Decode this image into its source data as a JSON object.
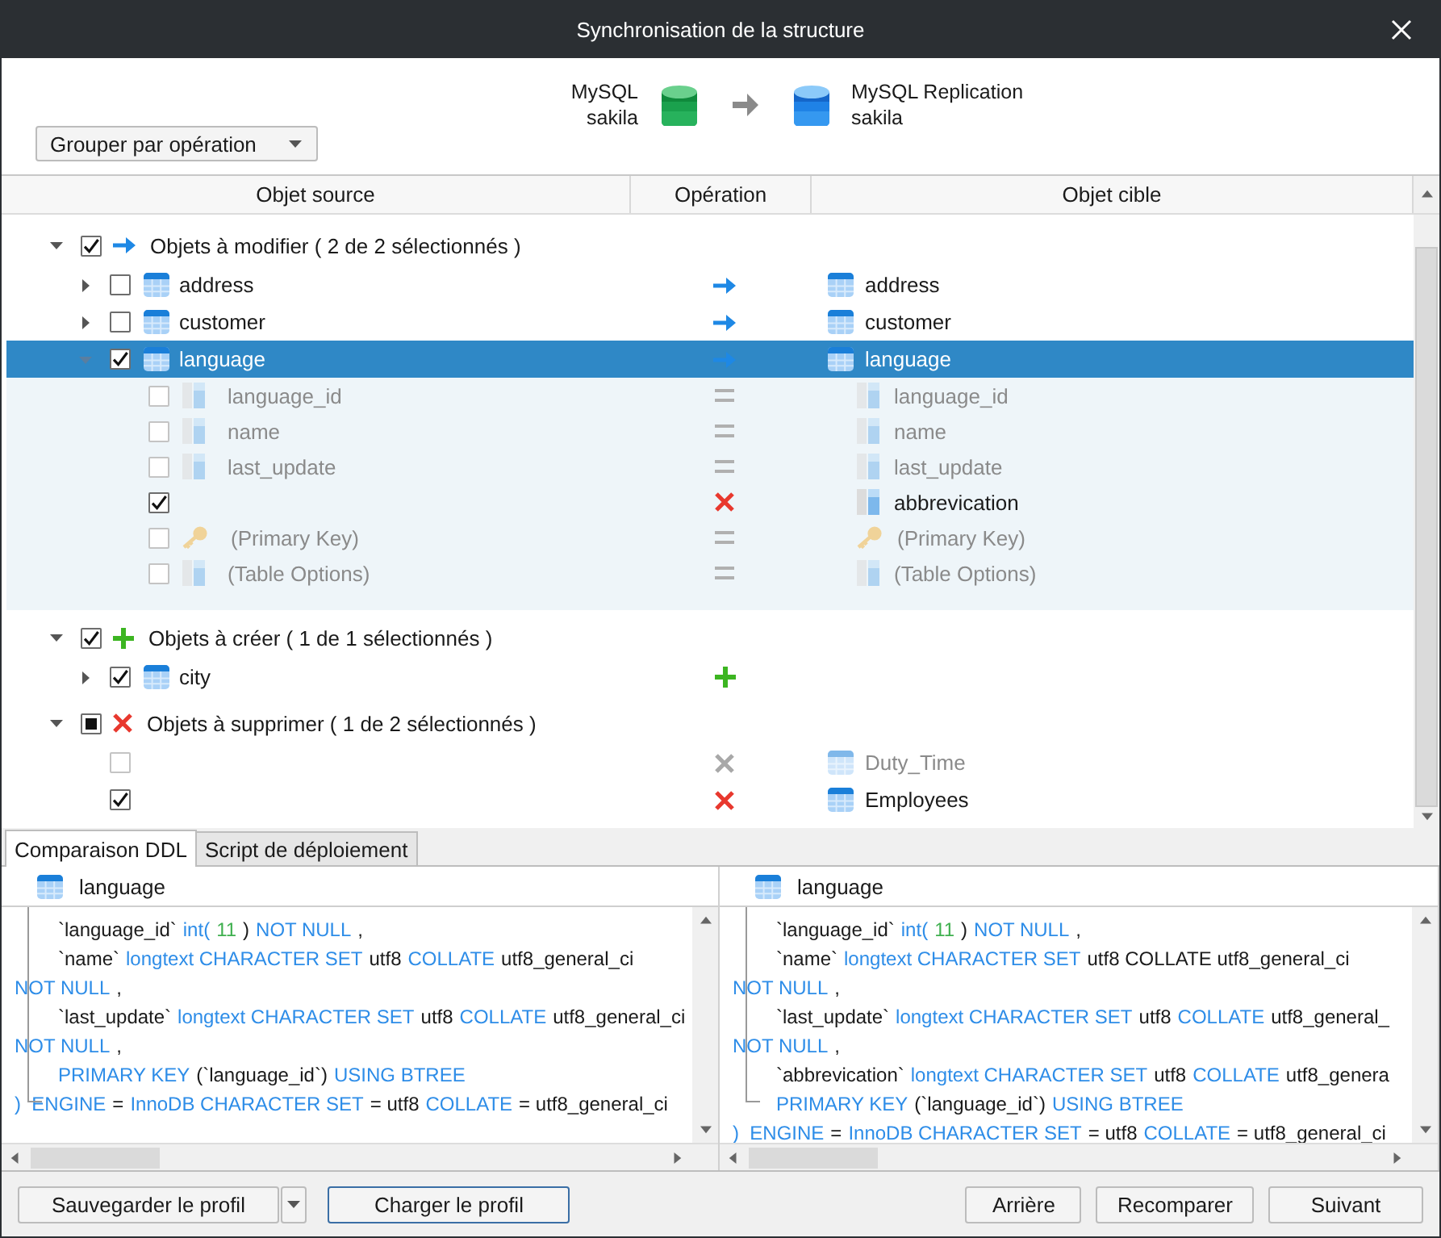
{
  "window": {
    "title": "Synchronisation de la structure"
  },
  "source": {
    "server": "MySQL",
    "database": "sakila"
  },
  "target": {
    "server": "MySQL Replication",
    "database": "sakila"
  },
  "group_by": {
    "value": "Grouper par opération"
  },
  "columns": [
    "Objet source",
    "Opération",
    "Objet cible"
  ],
  "groups": [
    {
      "label": "Objets à modifier ( 2 de 2 sélectionnés )",
      "kind": "modify",
      "checked": true,
      "expanded": true,
      "items": [
        {
          "source": "address",
          "target": "address",
          "kind": "table",
          "operation": {
            "kind": "modify"
          },
          "checked": false,
          "selected": false,
          "dimmed": false,
          "expanded": false
        },
        {
          "source": "customer",
          "target": "customer",
          "kind": "table",
          "operation": {
            "kind": "modify"
          },
          "checked": false,
          "selected": false,
          "dimmed": false,
          "expanded": false
        },
        {
          "source": "language",
          "target": "language",
          "kind": "table",
          "operation": {
            "kind": "modify"
          },
          "checked": true,
          "selected": true,
          "dimmed": false,
          "expanded": true,
          "children": [
            {
              "source": "language_id",
              "target": "language_id",
              "kind": "column",
              "operation": {
                "kind": "equal"
              },
              "checked": false,
              "selected": false,
              "dimmed": true
            },
            {
              "source": "name",
              "target": "name",
              "kind": "column",
              "operation": {
                "kind": "equal"
              },
              "checked": false,
              "selected": false,
              "dimmed": true
            },
            {
              "source": "last_update",
              "target": "last_update",
              "kind": "column",
              "operation": {
                "kind": "equal"
              },
              "checked": false,
              "selected": false,
              "dimmed": true
            },
            {
              "target": "abbrevication",
              "kind": "column",
              "operation": {
                "kind": "delete"
              },
              "checked": true,
              "selected": false,
              "dimmed": false
            },
            {
              "source": "(Primary Key)",
              "target": "(Primary Key)",
              "kind": "key",
              "operation": {
                "kind": "equal"
              },
              "checked": false,
              "selected": false,
              "dimmed": true
            },
            {
              "source": "(Table Options)",
              "target": "(Table Options)",
              "kind": "column",
              "operation": {
                "kind": "equal"
              },
              "checked": false,
              "selected": false,
              "dimmed": true
            }
          ]
        }
      ]
    },
    {
      "label": "Objets à créer ( 1 de 1 sélectionnés )",
      "kind": "create",
      "checked": true,
      "expanded": true,
      "items": [
        {
          "source": "city",
          "kind": "table",
          "operation": {
            "kind": "create"
          },
          "checked": true,
          "selected": false,
          "dimmed": false,
          "expanded": false
        }
      ]
    },
    {
      "label": "Objets à supprimer ( 1 de 2 sélectionnés )",
      "kind": "delete",
      "checked": true,
      "partial": true,
      "expanded": true,
      "items": [
        {
          "target": "Duty_Time",
          "kind": "table",
          "operation": {
            "kind": "delete"
          },
          "checked": false,
          "selected": false,
          "dimmed": true
        },
        {
          "target": "Employees",
          "kind": "table",
          "operation": {
            "kind": "delete"
          },
          "checked": true,
          "selected": false,
          "dimmed": false
        }
      ]
    }
  ],
  "ddl_tabs": [
    {
      "label": "Comparaison DDL",
      "selected": true
    },
    {
      "label": "Script de déploiement",
      "selected": false
    }
  ],
  "ddl_panels": [
    {
      "title": "language",
      "lines": [
        {
          "indented": true,
          "tokens": [
            {
              "t": "`language_id`",
              "kind": "txt"
            },
            {
              "t": "int(",
              "kind": "kw"
            },
            {
              "t": "11",
              "kind": "num"
            },
            {
              "t": ")",
              "kind": "txt"
            },
            {
              "t": "NOT NULL",
              "kind": "kw"
            },
            {
              "t": ",",
              "kind": "txt"
            }
          ]
        },
        {
          "indented": true,
          "tokens": [
            {
              "t": "`name`",
              "kind": "txt"
            },
            {
              "t": "longtext CHARACTER SET",
              "kind": "kw"
            },
            {
              "t": "utf8",
              "kind": "txt"
            },
            {
              "t": "COLLATE",
              "kind": "kw"
            },
            {
              "t": "utf8_general_ci",
              "kind": "txt"
            }
          ]
        },
        {
          "indented": false,
          "tokens": [
            {
              "t": "NOT NULL",
              "kind": "kw"
            },
            {
              "t": ",",
              "kind": "txt"
            }
          ]
        },
        {
          "indented": true,
          "tokens": [
            {
              "t": "`last_update`",
              "kind": "txt"
            },
            {
              "t": "longtext CHARACTER SET",
              "kind": "kw"
            },
            {
              "t": "utf8",
              "kind": "txt"
            },
            {
              "t": "COLLATE",
              "kind": "kw"
            },
            {
              "t": "utf8_general_ci",
              "kind": "txt"
            }
          ]
        },
        {
          "indented": false,
          "tokens": [
            {
              "t": "NOT NULL",
              "kind": "kw"
            },
            {
              "t": ",",
              "kind": "txt"
            }
          ]
        },
        {
          "indented": true,
          "tokens": [
            {
              "t": "PRIMARY KEY",
              "kind": "kw"
            },
            {
              "t": "(`language_id`)",
              "kind": "txt"
            },
            {
              "t": "USING BTREE",
              "kind": "kw"
            }
          ]
        },
        {
          "indented": false,
          "tokens": [
            {
              "t": ")  ENGINE",
              "kind": "kw"
            },
            {
              "t": "=",
              "kind": "txt"
            },
            {
              "t": "InnoDB CHARACTER SET",
              "kind": "kw"
            },
            {
              "t": "= utf8",
              "kind": "txt"
            },
            {
              "t": "COLLATE",
              "kind": "kw"
            },
            {
              "t": "= utf8_general_ci",
              "kind": "txt"
            }
          ]
        }
      ]
    },
    {
      "title": "language",
      "lines": [
        {
          "indented": true,
          "tokens": [
            {
              "t": "`language_id`",
              "kind": "txt"
            },
            {
              "t": "int(",
              "kind": "kw"
            },
            {
              "t": "11",
              "kind": "num"
            },
            {
              "t": ")",
              "kind": "txt"
            },
            {
              "t": "NOT NULL",
              "kind": "kw"
            },
            {
              "t": ",",
              "kind": "txt"
            }
          ]
        },
        {
          "indented": true,
          "tokens": [
            {
              "t": "`name`",
              "kind": "txt"
            },
            {
              "t": "longtext CHARACTER SET",
              "kind": "kw"
            },
            {
              "t": "utf8 COLLATE utf8_general_ci",
              "kind": "txt"
            }
          ]
        },
        {
          "indented": false,
          "tokens": [
            {
              "t": "NOT NULL",
              "kind": "kw"
            },
            {
              "t": ",",
              "kind": "txt"
            }
          ]
        },
        {
          "indented": true,
          "tokens": [
            {
              "t": "`last_update`",
              "kind": "txt"
            },
            {
              "t": "longtext CHARACTER SET",
              "kind": "kw"
            },
            {
              "t": "utf8",
              "kind": "txt"
            },
            {
              "t": "COLLATE",
              "kind": "kw"
            },
            {
              "t": "utf8_general_",
              "kind": "txt"
            }
          ]
        },
        {
          "indented": false,
          "tokens": [
            {
              "t": "NOT NULL",
              "kind": "kw"
            },
            {
              "t": ",",
              "kind": "txt"
            }
          ]
        },
        {
          "indented": true,
          "tokens": [
            {
              "t": "`abbrevication`",
              "kind": "txt"
            },
            {
              "t": "longtext CHARACTER SET",
              "kind": "kw"
            },
            {
              "t": "utf8",
              "kind": "txt"
            },
            {
              "t": "COLLATE",
              "kind": "kw"
            },
            {
              "t": "utf8_genera",
              "kind": "txt"
            }
          ]
        },
        {
          "indented": true,
          "tokens": [
            {
              "t": "PRIMARY KEY",
              "kind": "kw"
            },
            {
              "t": "(`language_id`)",
              "kind": "txt"
            },
            {
              "t": "USING BTREE",
              "kind": "kw"
            }
          ]
        },
        {
          "indented": false,
          "tokens": [
            {
              "t": ")  ENGINE",
              "kind": "kw"
            },
            {
              "t": "=",
              "kind": "txt"
            },
            {
              "t": "InnoDB CHARACTER SET",
              "kind": "kw"
            },
            {
              "t": "= utf8",
              "kind": "txt"
            },
            {
              "t": "COLLATE",
              "kind": "kw"
            },
            {
              "t": "= utf8_general_ci",
              "kind": "txt"
            }
          ]
        }
      ]
    }
  ],
  "footer": {
    "left": [
      {
        "label": "Sauvegarder le profil",
        "split": true,
        "focused": false
      },
      {
        "label": "Charger le profil",
        "split": false,
        "focused": true
      }
    ],
    "right": [
      {
        "label": "Arrière",
        "split": false,
        "focused": false
      },
      {
        "label": "Recomparer",
        "split": false,
        "focused": false
      },
      {
        "label": "Suivant",
        "split": false,
        "focused": false
      }
    ]
  }
}
